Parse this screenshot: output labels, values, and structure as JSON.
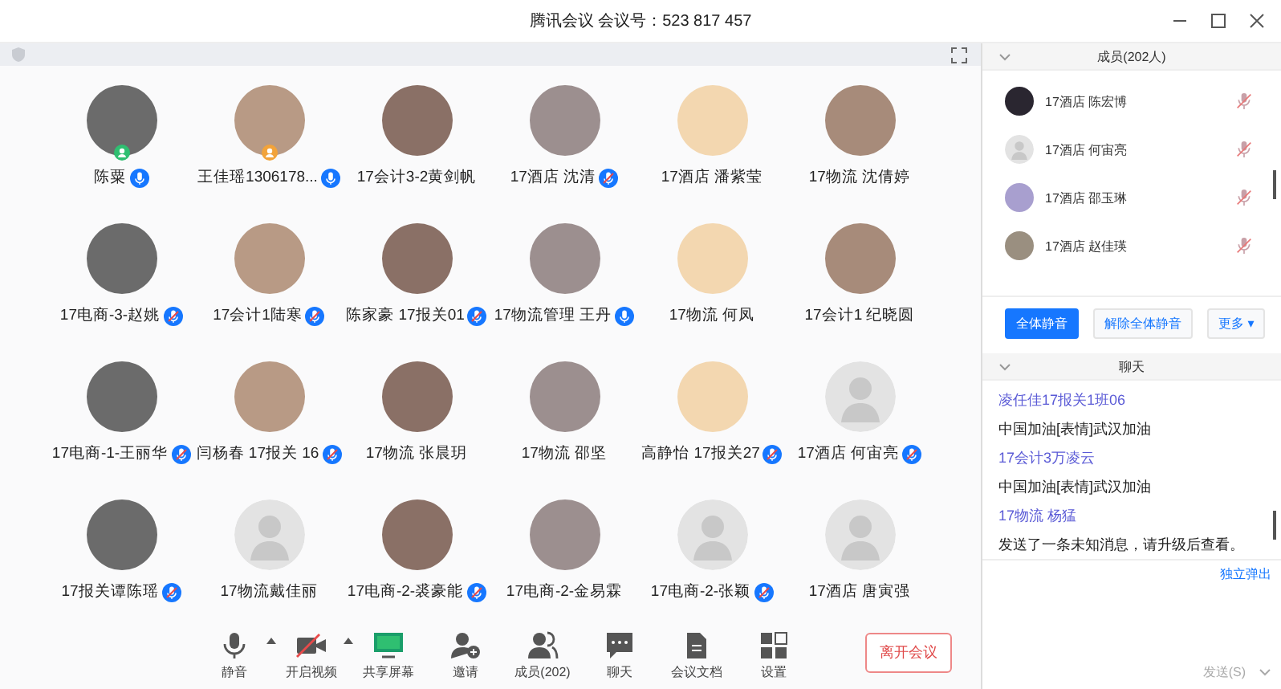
{
  "window": {
    "title": "腾讯会议 会议号：523 817 457"
  },
  "participants": [
    {
      "name": "陈粟",
      "default_avatar": false,
      "kind": "mic",
      "host": true,
      "cohost": false
    },
    {
      "name": "王佳瑶1306178...",
      "default_avatar": false,
      "kind": "mic",
      "host": false,
      "cohost": true
    },
    {
      "name": "17会计3-2黄剑帆",
      "default_avatar": false,
      "kind": "plain",
      "host": false,
      "cohost": false
    },
    {
      "name": "17酒店 沈清",
      "default_avatar": false,
      "kind": "muted",
      "host": false,
      "cohost": false
    },
    {
      "name": "17酒店 潘紫莹",
      "default_avatar": false,
      "kind": "plain",
      "host": false,
      "cohost": false
    },
    {
      "name": "17物流 沈倩婷",
      "default_avatar": false,
      "kind": "plain",
      "host": false,
      "cohost": false
    },
    {
      "name": "17电商-3-赵姚",
      "default_avatar": false,
      "kind": "muted",
      "host": false,
      "cohost": false
    },
    {
      "name": "17会计1陆寒",
      "default_avatar": false,
      "kind": "muted",
      "host": false,
      "cohost": false
    },
    {
      "name": "陈家豪 17报关01",
      "default_avatar": false,
      "kind": "muted",
      "host": false,
      "cohost": false
    },
    {
      "name": "17物流管理 王丹",
      "default_avatar": false,
      "kind": "mic",
      "host": false,
      "cohost": false
    },
    {
      "name": "17物流 何凤",
      "default_avatar": false,
      "kind": "plain",
      "host": false,
      "cohost": false
    },
    {
      "name": "17会计1 纪晓圆",
      "default_avatar": false,
      "kind": "plain",
      "host": false,
      "cohost": false
    },
    {
      "name": "17电商-1-王丽华",
      "default_avatar": false,
      "kind": "muted",
      "host": false,
      "cohost": false
    },
    {
      "name": "闫杨春 17报关 16",
      "default_avatar": false,
      "kind": "muted",
      "host": false,
      "cohost": false
    },
    {
      "name": "17物流 张晨玥",
      "default_avatar": false,
      "kind": "plain",
      "host": false,
      "cohost": false
    },
    {
      "name": "17物流 邵坚",
      "default_avatar": false,
      "kind": "plain",
      "host": false,
      "cohost": false
    },
    {
      "name": "高静怡 17报关27",
      "default_avatar": false,
      "kind": "muted",
      "host": false,
      "cohost": false
    },
    {
      "name": "17酒店 何宙亮",
      "default_avatar": true,
      "kind": "muted",
      "host": false,
      "cohost": false
    },
    {
      "name": "17报关谭陈瑶",
      "default_avatar": false,
      "kind": "muted",
      "host": false,
      "cohost": false
    },
    {
      "name": "17物流戴佳丽",
      "default_avatar": true,
      "kind": "plain",
      "host": false,
      "cohost": false
    },
    {
      "name": "17电商-2-裘豪能",
      "default_avatar": false,
      "kind": "muted",
      "host": false,
      "cohost": false
    },
    {
      "name": "17电商-2-金易霖",
      "default_avatar": false,
      "kind": "plain",
      "host": false,
      "cohost": false
    },
    {
      "name": "17电商-2-张颖",
      "default_avatar": true,
      "kind": "muted",
      "host": false,
      "cohost": false
    },
    {
      "name": "17酒店 唐寅强",
      "default_avatar": true,
      "kind": "plain",
      "host": false,
      "cohost": false
    }
  ],
  "toolbar": [
    {
      "label": "静音",
      "kind": "mic",
      "dropdown": true
    },
    {
      "label": "开启视频",
      "kind": "camera",
      "dropdown": true
    },
    {
      "label": "共享屏幕",
      "kind": "screen",
      "dropdown": false
    },
    {
      "label": "邀请",
      "kind": "invite",
      "dropdown": false
    },
    {
      "label": "成员(202)",
      "kind": "members",
      "dropdown": false
    },
    {
      "label": "聊天",
      "kind": "chat",
      "dropdown": false
    },
    {
      "label": "会议文档",
      "kind": "doc",
      "dropdown": false
    },
    {
      "label": "设置",
      "kind": "grid",
      "dropdown": false
    }
  ],
  "leave_button": "离开会议",
  "members_panel": {
    "title": "成员(202人)",
    "members": [
      {
        "name": "17酒店 陈宏博",
        "default_avatar": false
      },
      {
        "name": "17酒店 何宙亮",
        "default_avatar": true
      },
      {
        "name": "17酒店 邵玉琳",
        "default_avatar": false
      },
      {
        "name": "17酒店 赵佳瑛",
        "default_avatar": false
      }
    ],
    "buttons": [
      {
        "label": "全体静音",
        "primary": true
      },
      {
        "label": "解除全体静音",
        "primary": false
      },
      {
        "label": "更多 ▾",
        "primary": false
      }
    ]
  },
  "chat_panel": {
    "title": "聊天",
    "messages": [
      {
        "kind": "sender",
        "text": "凌任佳17报关1班06"
      },
      {
        "kind": "message",
        "text": "中国加油[表情]武汉加油"
      },
      {
        "kind": "sender",
        "text": "17会计3万凌云"
      },
      {
        "kind": "message",
        "text": "中国加油[表情]武汉加油"
      },
      {
        "kind": "sender",
        "text": "17物流 杨猛"
      },
      {
        "kind": "message",
        "text": "发送了一条未知消息，请升级后查看。"
      }
    ],
    "popout_link": "独立弹出",
    "send_button": "发送(S)"
  }
}
